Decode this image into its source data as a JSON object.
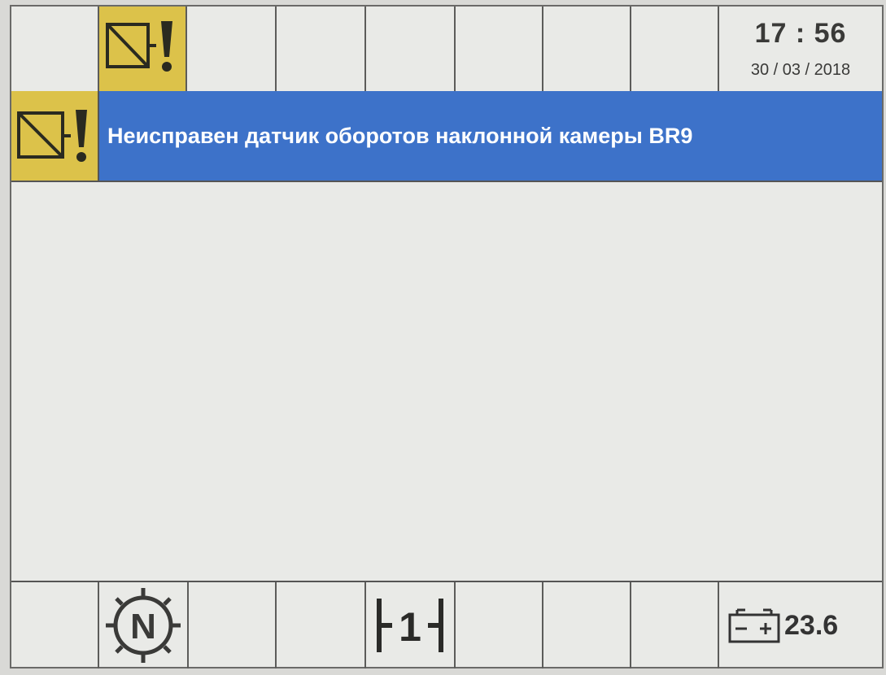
{
  "top_bar": {
    "time": "17 : 56",
    "date": "30 / 03 / 2018",
    "fault_icon": "sensor-fault-icon"
  },
  "alert": {
    "icon": "sensor-fault-icon",
    "message": "Неисправен датчик оборотов наклонной камеры BR9",
    "background_color": "#3d72c9",
    "icon_color": "#dcc24a"
  },
  "bottom_bar": {
    "neutral_icon": "neutral-gear-icon",
    "neutral_label": "N",
    "gear_icon": "gear-range-icon",
    "gear_label": "1",
    "battery_icon": "battery-icon",
    "voltage": "23.6"
  }
}
